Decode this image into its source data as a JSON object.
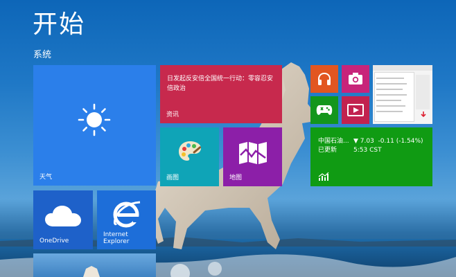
{
  "header": {
    "title": "开始",
    "group_label": "系统"
  },
  "tiles": {
    "weather": {
      "label": "天气",
      "color": "#2b7fea"
    },
    "news": {
      "headline": "日发起反安倍全国统一行动：零容忍安倍政治",
      "label": "资讯",
      "color": "#c7294d"
    },
    "photos": {
      "label": "画图",
      "color": "#0fa4b7"
    },
    "maps": {
      "label": "地图",
      "color": "#8c1fa8"
    },
    "music": {
      "color": "#e25621"
    },
    "camera": {
      "color": "#c8247a"
    },
    "xbox": {
      "color": "#14961c"
    },
    "video": {
      "color": "#c2224f"
    },
    "finance": {
      "name": "中国石油...",
      "status": "已更新",
      "change": "▼ 7.03  -0.11 (-1.54%)",
      "time": "5:53 CST",
      "color": "#109b13"
    },
    "onedrive": {
      "label": "OneDrive",
      "color": "#1e61c9"
    },
    "ie": {
      "label_line1": "Internet",
      "label_line2": "Explorer",
      "color": "#1d6ed9"
    }
  }
}
